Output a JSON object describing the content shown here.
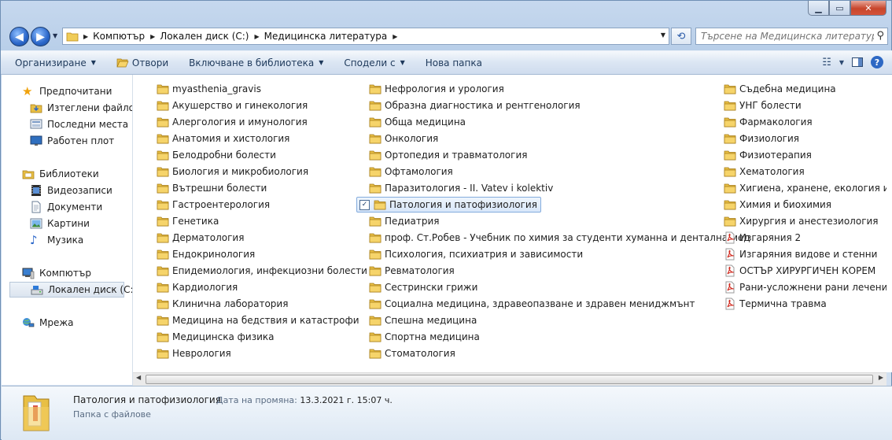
{
  "window": {
    "min_glyph": "▁",
    "max_glyph": "▭",
    "close_glyph": "✕"
  },
  "nav": {
    "back_glyph": "◀",
    "forward_glyph": "▶",
    "breadcrumb": [
      "Компютър",
      "Локален диск (C:)",
      "Медицинска литература"
    ],
    "search_placeholder": "Търсене на Медицинска литература"
  },
  "toolbar": {
    "organize": "Организиране",
    "open": "Отвори",
    "include_library": "Включване в библиотека",
    "share": "Сподели с",
    "new_folder": "Нова папка",
    "help": "?"
  },
  "navpane": {
    "favorites": "Предпочитани",
    "downloads": "Изтеглени файлове",
    "recent": "Последни места",
    "desktop": "Работен плот",
    "libraries": "Библиотеки",
    "videos": "Видеозаписи",
    "documents": "Документи",
    "pictures": "Картини",
    "music": "Музика",
    "computer": "Компютър",
    "local_disk": "Локален диск (C:)",
    "network": "Мрежа"
  },
  "files": {
    "col1": [
      "myasthenia_gravis",
      "Акушерство и гинекология",
      "Алергология и имунология",
      "Анатомия и хистология",
      "Белодробни болести",
      "Биология и микробиология",
      "Вътрешни болести",
      "Гастроентерология",
      "Генетика",
      "Дерматология",
      "Ендокринология",
      "Епидемиология, инфекциозни болести",
      "Кардиология",
      "Клинична лаборатория",
      "Медицина на бедствия и катастрофи",
      "Медицинска физика",
      "Неврология"
    ],
    "col2": [
      "Нефрология и урология",
      "Образна диагностика и рентгенология",
      "Обща медицина",
      "Онкология",
      "Ортопедия и травматология",
      "Офтамология",
      "Паразитология - II. Vatev i kolektiv",
      "Патология и патофизиология",
      "Педиатрия",
      "проф. Ст.Робев - Учебник по химия за студенти хуманна и дентална мед",
      "Психология, психиатрия и зависимости",
      "Ревматология",
      "Сестрински грижи",
      "Социална медицина, здравеопазване и здравен мениджмънт",
      "Спешна медицина",
      "Спортна медицина",
      "Стоматология"
    ],
    "col3": [
      "Съдебна медицина",
      "УНГ болести",
      "Фармакология",
      "Физиология",
      "Физиотерапия",
      "Хематология",
      "Хигиена, хранене, екология и труд",
      "Химия и биохимия",
      "Хирургия и анестезиология"
    ],
    "col3_pdf": [
      "Изгаряния 2",
      "Изгаряния видове и стенни",
      "ОСТЪР ХИРУРГИЧЕН КОРЕМ",
      "Рани-усложнени рани лечение",
      "Термична травма"
    ],
    "selected_check": "✓"
  },
  "details": {
    "name": "Патология и патофизиология",
    "modified_label": "Дата на промяна:",
    "modified_value": "13.3.2021 г. 15:07 ч.",
    "type": "Папка с файлове"
  }
}
